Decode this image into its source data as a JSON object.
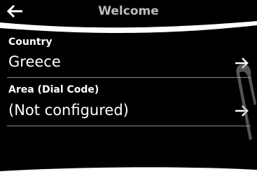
{
  "header": {
    "title": "Welcome",
    "back_icon": "arrow-left-icon"
  },
  "settings": [
    {
      "label": "Country",
      "value": "Greece",
      "icon": "arrow-right-icon"
    },
    {
      "label": "Area (Dial Code)",
      "value": "(Not configured)",
      "icon": "arrow-right-icon"
    }
  ],
  "colors": {
    "background": "#000000",
    "text": "#ffffff",
    "title": "#bdbdbd",
    "divider": "#8a8a8a"
  }
}
